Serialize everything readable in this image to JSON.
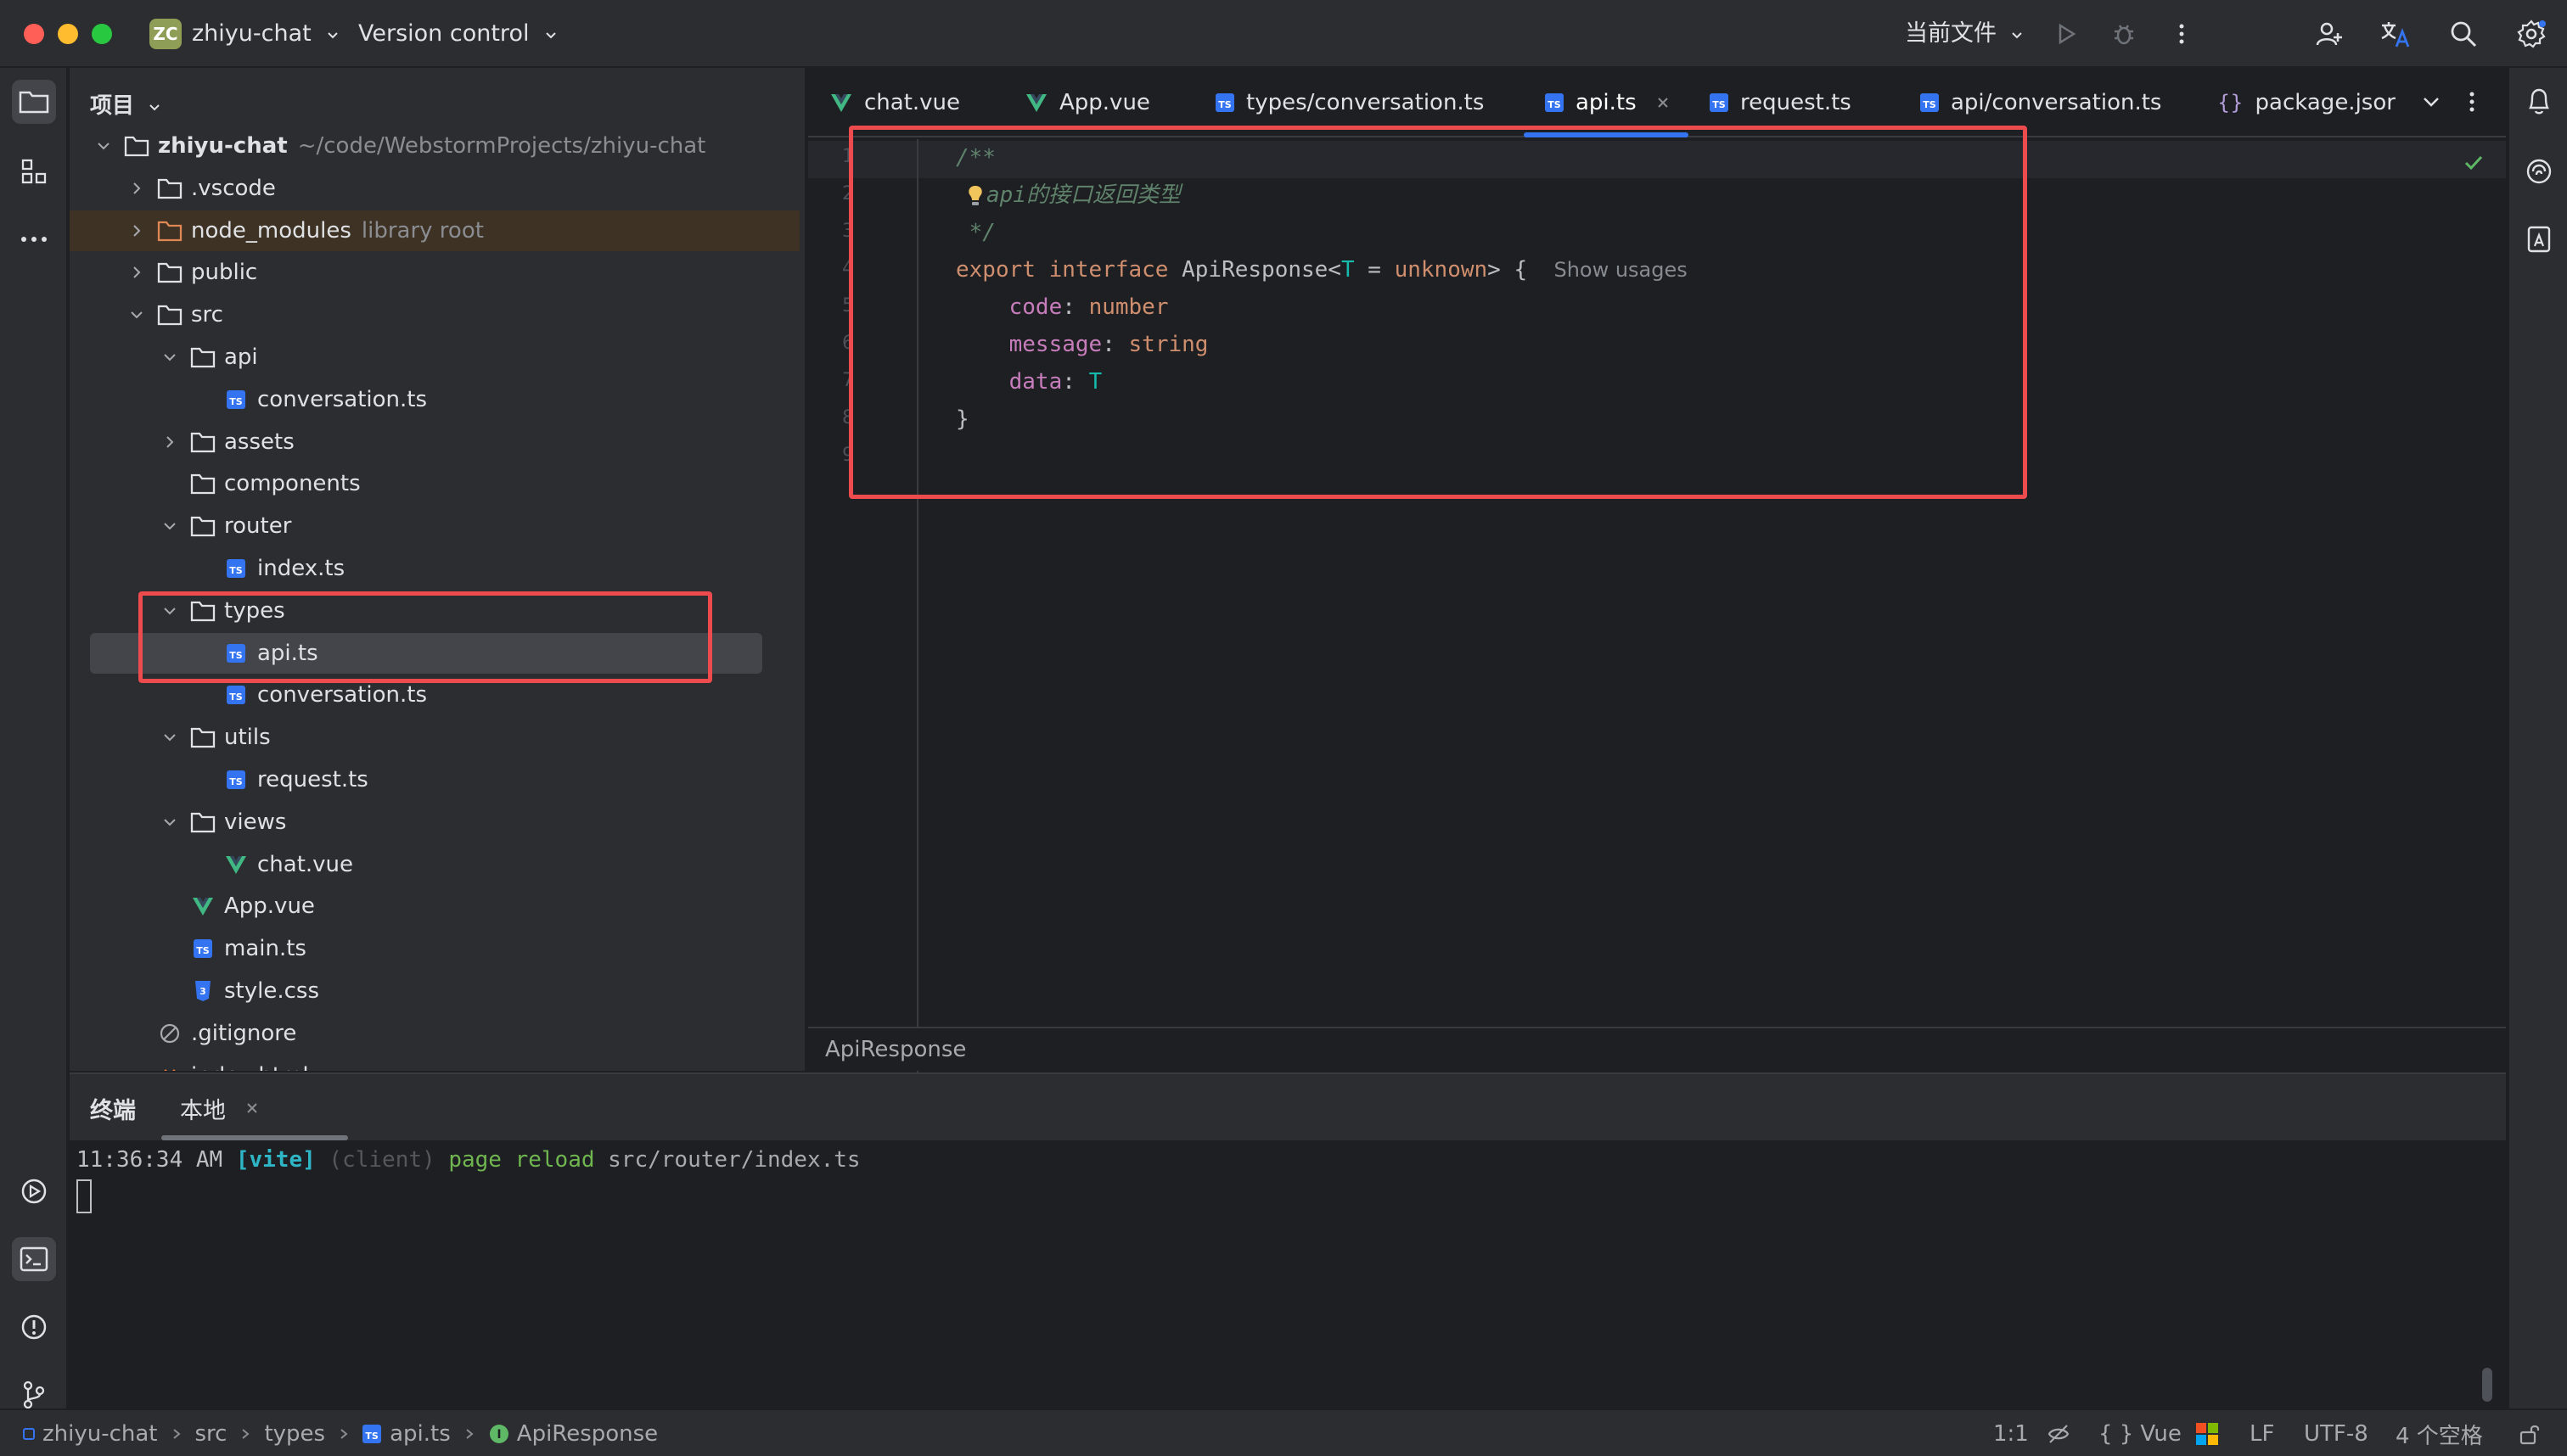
{
  "titlebar": {
    "project_badge": "ZC",
    "project_name": "zhiyu-chat",
    "vcs_label": "Version control",
    "run_config": "当前文件",
    "colors": {
      "red": "#ff5f57",
      "yellow": "#febc2e",
      "green": "#28c840"
    }
  },
  "project_panel": {
    "header": "项目",
    "tree": [
      {
        "label": "zhiyu-chat",
        "hint": "~/code/WebstormProjects/zhiyu-chat",
        "type": "folder",
        "depth": 0,
        "expanded": true
      },
      {
        "label": ".vscode",
        "type": "folder",
        "depth": 1,
        "expanded": false
      },
      {
        "label": "node_modules",
        "hint": "library root",
        "type": "folder-lib",
        "depth": 1,
        "expanded": false
      },
      {
        "label": "public",
        "type": "folder",
        "depth": 1,
        "expanded": false
      },
      {
        "label": "src",
        "type": "folder",
        "depth": 1,
        "expanded": true
      },
      {
        "label": "api",
        "type": "folder",
        "depth": 2,
        "expanded": true
      },
      {
        "label": "conversation.ts",
        "type": "ts",
        "depth": 3
      },
      {
        "label": "assets",
        "type": "folder",
        "depth": 2,
        "expanded": false
      },
      {
        "label": "components",
        "type": "folder",
        "depth": 2,
        "expanded": null
      },
      {
        "label": "router",
        "type": "folder",
        "depth": 2,
        "expanded": true
      },
      {
        "label": "index.ts",
        "type": "ts",
        "depth": 3
      },
      {
        "label": "types",
        "type": "folder",
        "depth": 2,
        "expanded": true
      },
      {
        "label": "api.ts",
        "type": "ts",
        "depth": 3,
        "selected": true
      },
      {
        "label": "conversation.ts",
        "type": "ts",
        "depth": 3
      },
      {
        "label": "utils",
        "type": "folder",
        "depth": 2,
        "expanded": true
      },
      {
        "label": "request.ts",
        "type": "ts",
        "depth": 3
      },
      {
        "label": "views",
        "type": "folder",
        "depth": 2,
        "expanded": true
      },
      {
        "label": "chat.vue",
        "type": "vue",
        "depth": 3
      },
      {
        "label": "App.vue",
        "type": "vue",
        "depth": 2
      },
      {
        "label": "main.ts",
        "type": "ts",
        "depth": 2
      },
      {
        "label": "style.css",
        "type": "css",
        "depth": 2
      },
      {
        "label": ".gitignore",
        "type": "ignore",
        "depth": 1
      },
      {
        "label": "index.html",
        "type": "html",
        "depth": 1
      }
    ]
  },
  "editor": {
    "tabs": [
      {
        "label": "chat.vue",
        "type": "vue"
      },
      {
        "label": "App.vue",
        "type": "vue"
      },
      {
        "label": "types/conversation.ts",
        "type": "ts"
      },
      {
        "label": "api.ts",
        "type": "ts",
        "active": true
      },
      {
        "label": "request.ts",
        "type": "ts"
      },
      {
        "label": "api/conversation.ts",
        "type": "ts"
      },
      {
        "label": "package.jsor",
        "type": "json"
      }
    ],
    "code": {
      "l1": "/**",
      "l2": "api的接口返回类型",
      "l3": " */",
      "l4_export": "export",
      "l4_interface": "interface",
      "l4_name": "ApiResponse<",
      "l4_T": "T",
      "l4_eq": " = ",
      "l4_unknown": "unknown",
      "l4_close": "> {",
      "l4_hint": "Show usages",
      "l5_prop": "code",
      "l5_type": "number",
      "l6_prop": "message",
      "l6_type": "string",
      "l7_prop": "data",
      "l7_type": "T",
      "l8": "}"
    },
    "breadcrumb": "ApiResponse"
  },
  "terminal": {
    "tab_title": "终端",
    "tab_local": "本地",
    "line_time": "11:36:34 AM",
    "line_vite": "[vite]",
    "line_client": "(client)",
    "line_action": "page reload",
    "line_path": "src/router/index.ts"
  },
  "statusbar": {
    "crumbs": [
      "zhiyu-chat",
      "src",
      "types",
      "api.ts",
      "ApiResponse"
    ],
    "position": "1:1",
    "lang": "Vue",
    "line_sep": "LF",
    "encoding": "UTF-8",
    "indent": "4 个空格"
  }
}
